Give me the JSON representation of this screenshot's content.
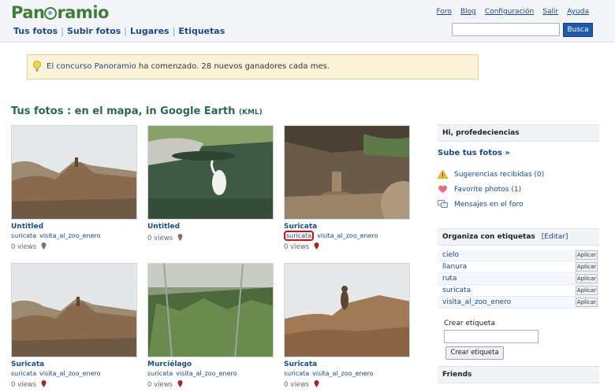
{
  "header": {
    "logo_text": "Panoramio",
    "nav": [
      "Tus fotos",
      "Subir fotos",
      "Lugares",
      "Etiquetas"
    ],
    "top_links": [
      "Foro",
      "Blog",
      "Configuración",
      "Salir",
      "Ayuda"
    ],
    "search_value": "",
    "search_button": "Busca"
  },
  "notice": {
    "link": "El concurso Panoramio",
    "text": " ha comenzado. 28 nuevos ganadores cada mes."
  },
  "page_title": {
    "main": "Tus fotos : en el mapa, in Google Earth ",
    "kml": "(KML)"
  },
  "photos": [
    {
      "title": "Untitled",
      "tags": [
        "suricata",
        "visita_al_zoo_enero"
      ],
      "views": "0 views",
      "highlight_tag": ""
    },
    {
      "title": "Untitled",
      "tags": [],
      "views": "0 views",
      "highlight_tag": ""
    },
    {
      "title": "Suricata",
      "tags": [
        "suricata",
        "visita_al_zoo_enero"
      ],
      "views": "0 views",
      "highlight_tag": "suricata"
    },
    {
      "title": "Suricata",
      "tags": [
        "suricata",
        "visita_al_zoo_enero"
      ],
      "views": "0 views",
      "highlight_tag": ""
    },
    {
      "title": "Murciélago",
      "tags": [
        "suricata",
        "visita_al_zoo_enero"
      ],
      "views": "0 views",
      "highlight_tag": ""
    },
    {
      "title": "Suricata",
      "tags": [
        "suricata",
        "visita_al_zoo_enero"
      ],
      "views": "0 views",
      "highlight_tag": ""
    }
  ],
  "sidebar": {
    "greeting": "Hi, profedeciencias",
    "upload": "Sube tus fotos »",
    "links": [
      {
        "label": "Sugerencias recibidas (0)",
        "icon": "warning-icon"
      },
      {
        "label": "Favorite photos (1)",
        "icon": "heart-icon"
      },
      {
        "label": "Mensajes en el foro",
        "icon": "chat-icon"
      }
    ],
    "tags_title": "Organiza con etiquetas",
    "tags_edit": "[Editar]",
    "tags": [
      "cielo",
      "llanura",
      "ruta",
      "suricata",
      "visita_al_zoo_enero"
    ],
    "apply_label": "Aplicar",
    "create_label": "Crear etiqueta",
    "create_button": "Crear etiqueta",
    "friends": "Friends"
  }
}
